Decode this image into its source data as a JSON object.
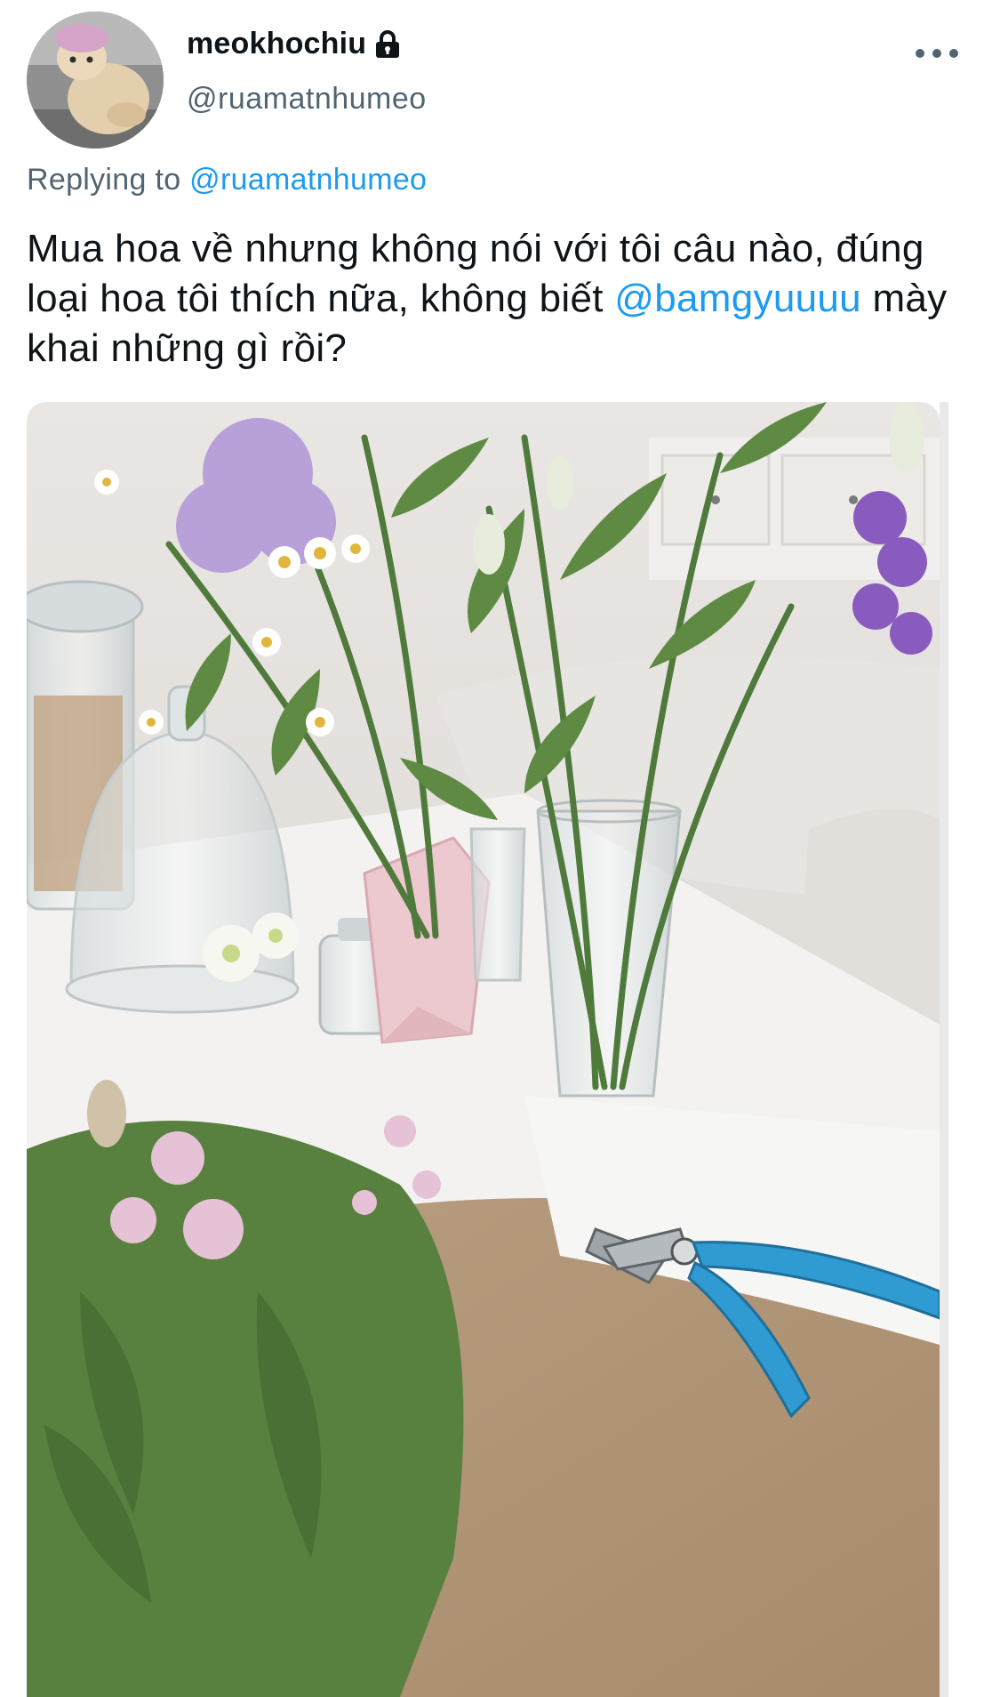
{
  "tweet": {
    "author": {
      "display_name": "meokhochiu",
      "handle": "@ruamatnhumeo",
      "locked_icon": "lock-icon",
      "avatar": "cat-photo"
    },
    "more_icon": "more-horizontal-icon",
    "reply_prefix": "Replying to",
    "reply_to": "@ruamatnhumeo",
    "text_part1": "Mua hoa về nhưng không nói với tôi câu nào, đúng loại hoa tôi thích nữa, không biết",
    "mention": "@bamgyuuuu",
    "text_part2": "mày khai những gì rồi?",
    "media": {
      "type": "photo",
      "subject": "flowers-vases-pruning-shears"
    }
  },
  "colors": {
    "link": "#1d9bf0",
    "secondary_text": "#536471",
    "primary_text": "#0f1419"
  }
}
